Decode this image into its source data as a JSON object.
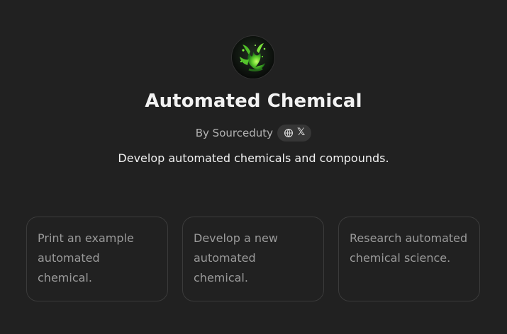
{
  "assistant": {
    "title": "Automated Chemical",
    "author_label": "By Sourceduty",
    "description": "Develop automated chemicals and compounds."
  },
  "social": {
    "website_icon": "globe-icon",
    "x_icon": "x-logo-icon",
    "x_symbol": "𝕏"
  },
  "prompts": [
    {
      "label": "Print an example automated chemical."
    },
    {
      "label": "Develop a new automated chemical."
    },
    {
      "label": "Research automated chemical science."
    }
  ],
  "colors": {
    "background": "#212121",
    "card_border": "#3b3b3b",
    "pill_background": "#363636",
    "title_text": "#f2f2f2",
    "muted_text": "#9a9a9a",
    "avatar_green": "#5fd12b"
  }
}
